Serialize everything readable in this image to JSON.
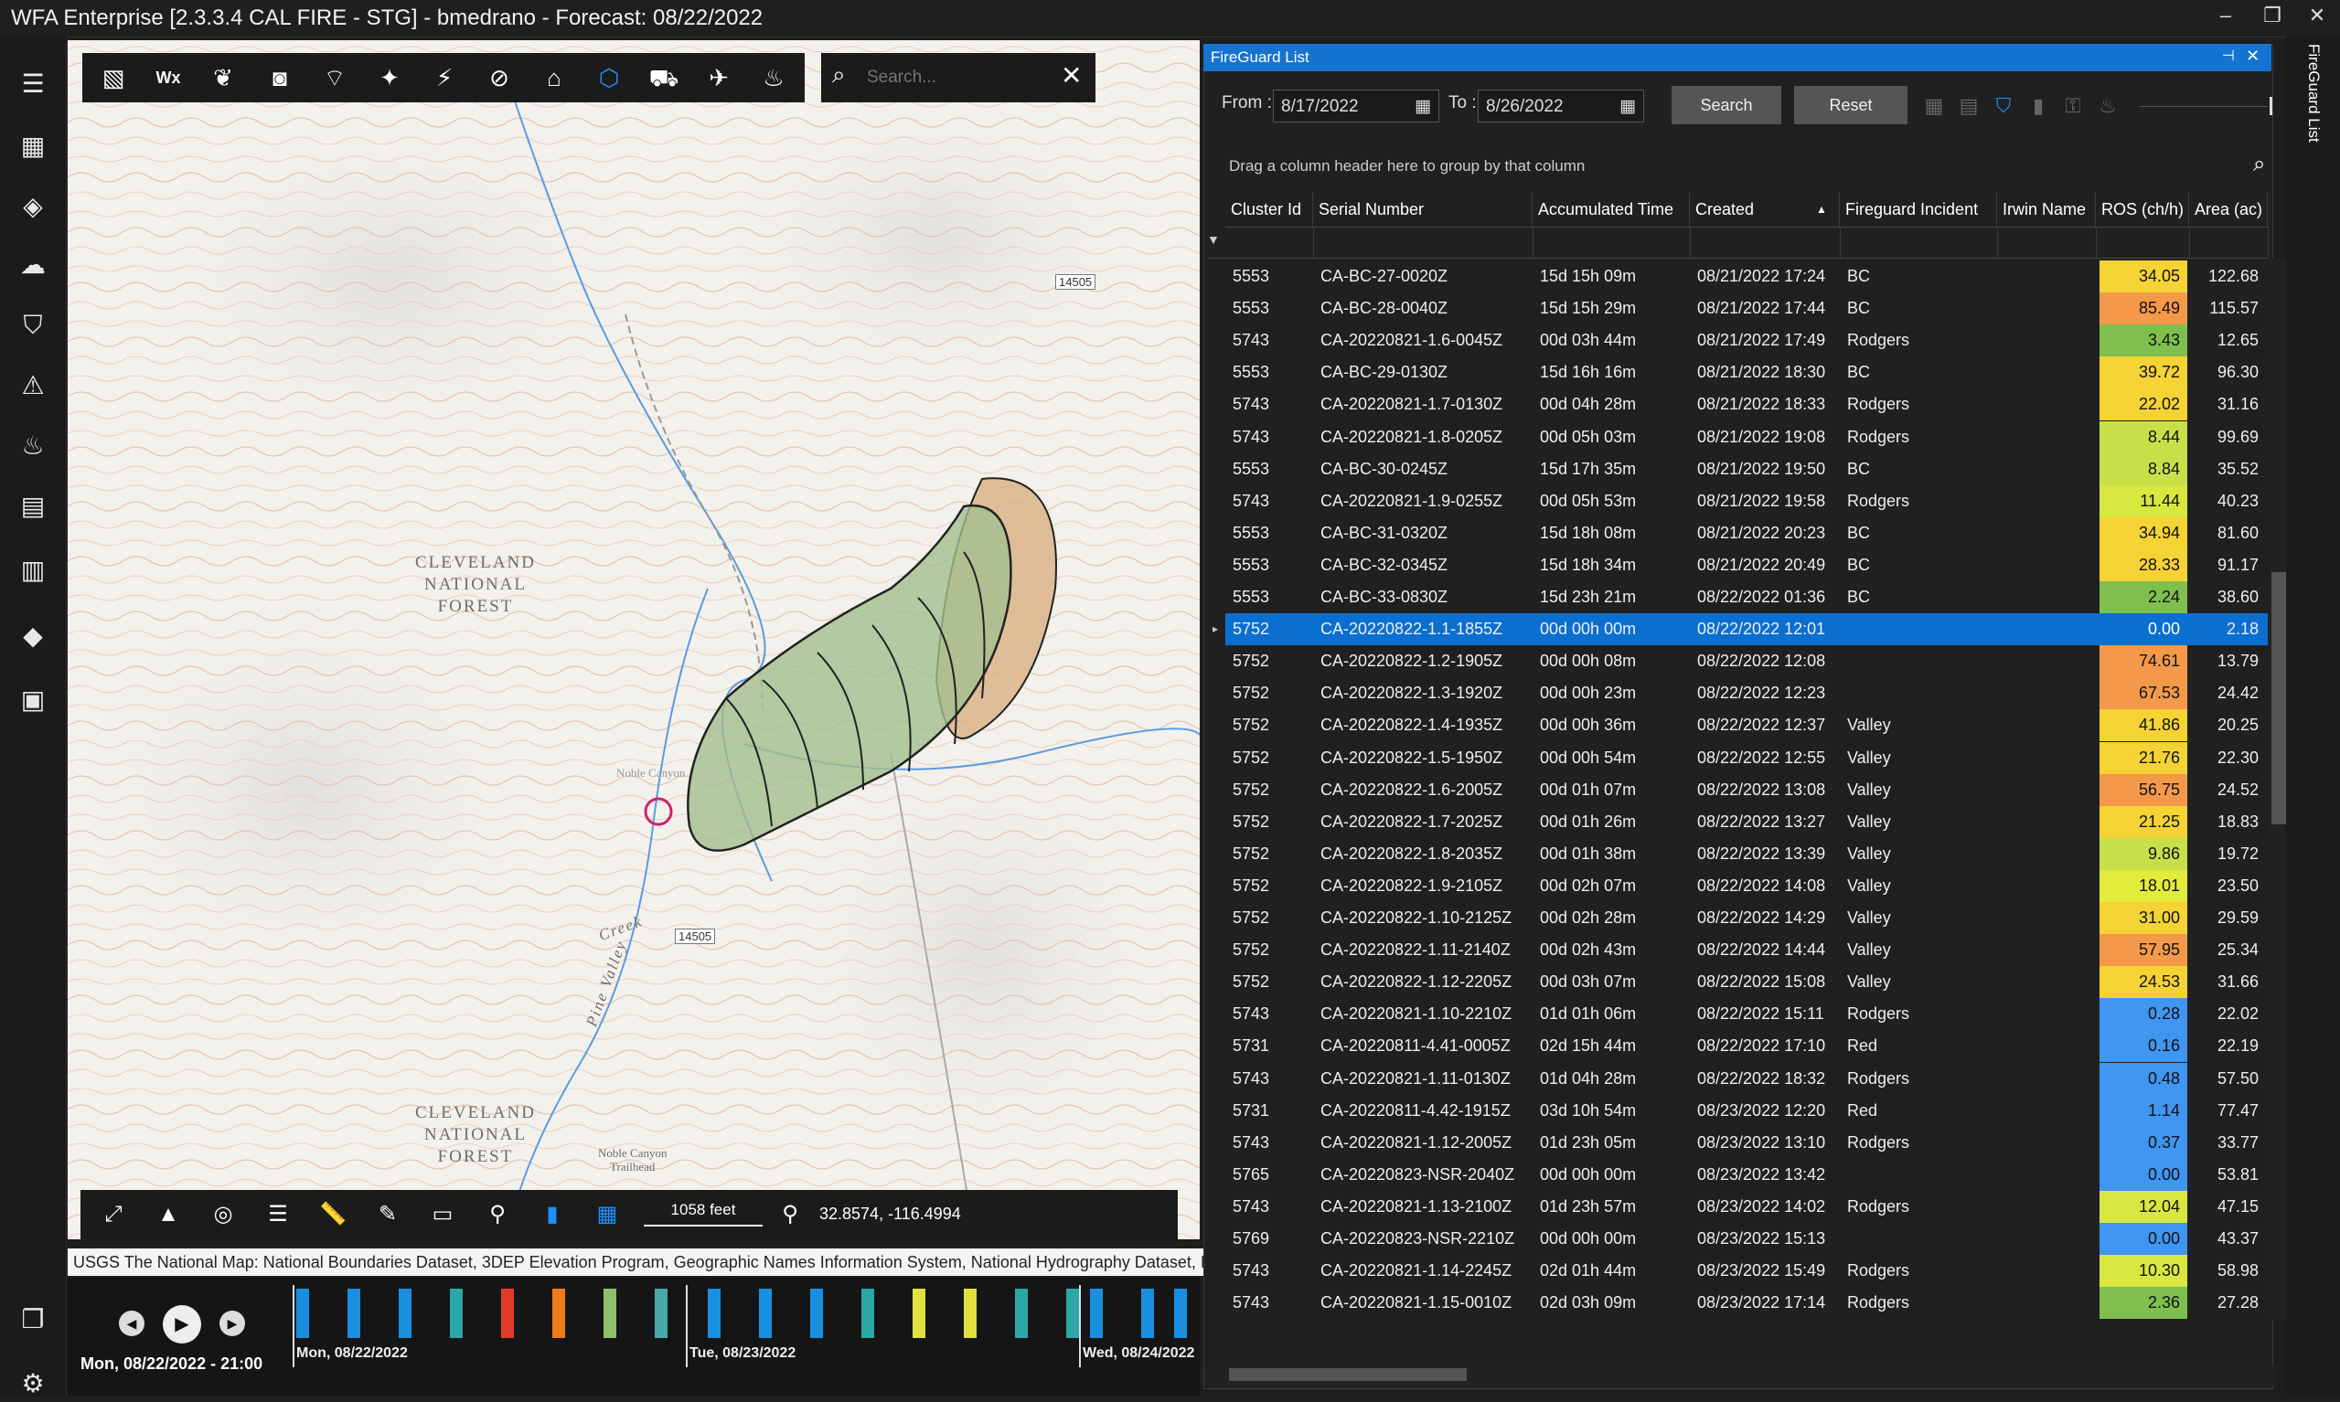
{
  "app": {
    "title": "WFA Enterprise [2.3.3.4 CAL FIRE - STG] - bmedrano - Forecast: 08/22/2022",
    "min": "–",
    "max": "❐",
    "close": "✕"
  },
  "map": {
    "search_placeholder": "Search...",
    "labels": {
      "forest1": "CLEVELAND\nNATIONAL\nFOREST",
      "forest2": "CLEVELAND\nNATIONAL\nFOREST",
      "creek": "Creek",
      "valley": "Pine Valley",
      "trailhead": "Noble Canyon\nTrailhead",
      "canyon": "Noble Canyon"
    },
    "shields": [
      "14505",
      "14505"
    ],
    "scale": "1058 feet",
    "coords": "32.8574, -116.4994",
    "attribution": "USGS The National Map: National Boundaries Dataset, 3DEP Elevation Program, Geographic Names Information System, National Hydrography Dataset, Nat"
  },
  "timeline": {
    "current": "Mon, 08/22/2022 - 21:00",
    "dates": [
      "Mon, 08/22/2022",
      "Tue, 08/23/2022",
      "Wed, 08/24/2022"
    ],
    "bars": [
      "#1a8fe0",
      "#1a8fe0",
      "#1a8fe0",
      "#2aa8a8",
      "#e23b2a",
      "#ee7a1a",
      "#8fbf6a",
      "#4aa8a8",
      "#1a8fe0",
      "#1a8fe0",
      "#1a8fe0",
      "#2aa8a8",
      "#e0e040",
      "#e0e040",
      "#2aa8a8",
      "#2aa8a8",
      "#1a8fe0",
      "#1a8fe0",
      "#1a8fe0"
    ]
  },
  "panel": {
    "title": "FireGuard List",
    "side_tab": "FireGuard List",
    "from_label": "From :",
    "from_value": "8/17/2022",
    "to_label": "To :",
    "to_value": "8/26/2022",
    "search_button": "Search",
    "reset_button": "Reset",
    "group_hint": "Drag a column header here to group by that column",
    "columns": [
      "Cluster Id",
      "Serial Number",
      "Accumulated Time",
      "Created",
      "Fireguard Incident",
      "Irwin Name",
      "ROS (ch/h)",
      "Area (ac)"
    ],
    "rows": [
      {
        "cluster": "5553",
        "serial": "CA-BC-27-0020Z",
        "acc": "15d 15h 09m",
        "created": "08/21/2022 17:24",
        "incident": "BC",
        "irwin": "",
        "ros": "34.05",
        "area": "122.68",
        "color": "#f5d335"
      },
      {
        "cluster": "5553",
        "serial": "CA-BC-28-0040Z",
        "acc": "15d 15h 29m",
        "created": "08/21/2022 17:44",
        "incident": "BC",
        "irwin": "",
        "ros": "85.49",
        "area": "115.57",
        "color": "#f4994a"
      },
      {
        "cluster": "5743",
        "serial": "CA-20220821-1.6-0045Z",
        "acc": "00d 03h 44m",
        "created": "08/21/2022 17:49",
        "incident": "Rodgers",
        "irwin": "",
        "ros": "3.43",
        "area": "12.65",
        "color": "#7fbf4f"
      },
      {
        "cluster": "5553",
        "serial": "CA-BC-29-0130Z",
        "acc": "15d 16h 16m",
        "created": "08/21/2022 18:30",
        "incident": "BC",
        "irwin": "",
        "ros": "39.72",
        "area": "96.30",
        "color": "#f5d335"
      },
      {
        "cluster": "5743",
        "serial": "CA-20220821-1.7-0130Z",
        "acc": "00d 04h 28m",
        "created": "08/21/2022 18:33",
        "incident": "Rodgers",
        "irwin": "",
        "ros": "22.02",
        "area": "31.16",
        "color": "#f5d335"
      },
      {
        "cluster": "5743",
        "serial": "CA-20220821-1.8-0205Z",
        "acc": "00d 05h 03m",
        "created": "08/21/2022 19:08",
        "incident": "Rodgers",
        "irwin": "",
        "ros": "8.44",
        "area": "99.69",
        "color": "#c7e04a"
      },
      {
        "cluster": "5553",
        "serial": "CA-BC-30-0245Z",
        "acc": "15d 17h 35m",
        "created": "08/21/2022 19:50",
        "incident": "BC",
        "irwin": "",
        "ros": "8.84",
        "area": "35.52",
        "color": "#c7e04a"
      },
      {
        "cluster": "5743",
        "serial": "CA-20220821-1.9-0255Z",
        "acc": "00d 05h 53m",
        "created": "08/21/2022 19:58",
        "incident": "Rodgers",
        "irwin": "",
        "ros": "11.44",
        "area": "40.23",
        "color": "#d8e840"
      },
      {
        "cluster": "5553",
        "serial": "CA-BC-31-0320Z",
        "acc": "15d 18h 08m",
        "created": "08/21/2022 20:23",
        "incident": "BC",
        "irwin": "",
        "ros": "34.94",
        "area": "81.60",
        "color": "#f5d335"
      },
      {
        "cluster": "5553",
        "serial": "CA-BC-32-0345Z",
        "acc": "15d 18h 34m",
        "created": "08/21/2022 20:49",
        "incident": "BC",
        "irwin": "",
        "ros": "28.33",
        "area": "91.17",
        "color": "#f5d335"
      },
      {
        "cluster": "5553",
        "serial": "CA-BC-33-0830Z",
        "acc": "15d 23h 21m",
        "created": "08/22/2022 01:36",
        "incident": "BC",
        "irwin": "",
        "ros": "2.24",
        "area": "38.60",
        "color": "#7fbf4f"
      },
      {
        "cluster": "5752",
        "serial": "CA-20220822-1.1-1855Z",
        "acc": "00d 00h 00m",
        "created": "08/22/2022 12:01",
        "incident": "",
        "irwin": "",
        "ros": "0.00",
        "area": "2.18",
        "color": "#0b6fd0",
        "selected": true
      },
      {
        "cluster": "5752",
        "serial": "CA-20220822-1.2-1905Z",
        "acc": "00d 00h 08m",
        "created": "08/22/2022 12:08",
        "incident": "",
        "irwin": "",
        "ros": "74.61",
        "area": "13.79",
        "color": "#f4994a"
      },
      {
        "cluster": "5752",
        "serial": "CA-20220822-1.3-1920Z",
        "acc": "00d 00h 23m",
        "created": "08/22/2022 12:23",
        "incident": "",
        "irwin": "",
        "ros": "67.53",
        "area": "24.42",
        "color": "#f4994a"
      },
      {
        "cluster": "5752",
        "serial": "CA-20220822-1.4-1935Z",
        "acc": "00d 00h 36m",
        "created": "08/22/2022 12:37",
        "incident": "Valley",
        "irwin": "",
        "ros": "41.86",
        "area": "20.25",
        "color": "#f5d335"
      },
      {
        "cluster": "5752",
        "serial": "CA-20220822-1.5-1950Z",
        "acc": "00d 00h 54m",
        "created": "08/22/2022 12:55",
        "incident": "Valley",
        "irwin": "",
        "ros": "21.76",
        "area": "22.30",
        "color": "#f5d335"
      },
      {
        "cluster": "5752",
        "serial": "CA-20220822-1.6-2005Z",
        "acc": "00d 01h 07m",
        "created": "08/22/2022 13:08",
        "incident": "Valley",
        "irwin": "",
        "ros": "56.75",
        "area": "24.52",
        "color": "#f4994a"
      },
      {
        "cluster": "5752",
        "serial": "CA-20220822-1.7-2025Z",
        "acc": "00d 01h 26m",
        "created": "08/22/2022 13:27",
        "incident": "Valley",
        "irwin": "",
        "ros": "21.25",
        "area": "18.83",
        "color": "#f5d335"
      },
      {
        "cluster": "5752",
        "serial": "CA-20220822-1.8-2035Z",
        "acc": "00d 01h 38m",
        "created": "08/22/2022 13:39",
        "incident": "Valley",
        "irwin": "",
        "ros": "9.86",
        "area": "19.72",
        "color": "#c7e04a"
      },
      {
        "cluster": "5752",
        "serial": "CA-20220822-1.9-2105Z",
        "acc": "00d 02h 07m",
        "created": "08/22/2022 14:08",
        "incident": "Valley",
        "irwin": "",
        "ros": "18.01",
        "area": "23.50",
        "color": "#e2ec3a"
      },
      {
        "cluster": "5752",
        "serial": "CA-20220822-1.10-2125Z",
        "acc": "00d 02h 28m",
        "created": "08/22/2022 14:29",
        "incident": "Valley",
        "irwin": "",
        "ros": "31.00",
        "area": "29.59",
        "color": "#f5d335"
      },
      {
        "cluster": "5752",
        "serial": "CA-20220822-1.11-2140Z",
        "acc": "00d 02h 43m",
        "created": "08/22/2022 14:44",
        "incident": "Valley",
        "irwin": "",
        "ros": "57.95",
        "area": "25.34",
        "color": "#f4994a"
      },
      {
        "cluster": "5752",
        "serial": "CA-20220822-1.12-2205Z",
        "acc": "00d 03h 07m",
        "created": "08/22/2022 15:08",
        "incident": "Valley",
        "irwin": "",
        "ros": "24.53",
        "area": "31.66",
        "color": "#f5d335"
      },
      {
        "cluster": "5743",
        "serial": "CA-20220821-1.10-2210Z",
        "acc": "01d 01h 06m",
        "created": "08/22/2022 15:11",
        "incident": "Rodgers",
        "irwin": "",
        "ros": "0.28",
        "area": "22.02",
        "color": "#3f95f0"
      },
      {
        "cluster": "5731",
        "serial": "CA-20220811-4.41-0005Z",
        "acc": "02d 15h 44m",
        "created": "08/22/2022 17:10",
        "incident": "Red",
        "irwin": "",
        "ros": "0.16",
        "area": "22.19",
        "color": "#3f95f0"
      },
      {
        "cluster": "5743",
        "serial": "CA-20220821-1.11-0130Z",
        "acc": "01d 04h 28m",
        "created": "08/22/2022 18:32",
        "incident": "Rodgers",
        "irwin": "",
        "ros": "0.48",
        "area": "57.50",
        "color": "#3f95f0"
      },
      {
        "cluster": "5731",
        "serial": "CA-20220811-4.42-1915Z",
        "acc": "03d 10h 54m",
        "created": "08/23/2022 12:20",
        "incident": "Red",
        "irwin": "",
        "ros": "1.14",
        "area": "77.47",
        "color": "#3f95f0"
      },
      {
        "cluster": "5743",
        "serial": "CA-20220821-1.12-2005Z",
        "acc": "01d 23h 05m",
        "created": "08/23/2022 13:10",
        "incident": "Rodgers",
        "irwin": "",
        "ros": "0.37",
        "area": "33.77",
        "color": "#3f95f0"
      },
      {
        "cluster": "5765",
        "serial": "CA-20220823-NSR-2040Z",
        "acc": "00d 00h 00m",
        "created": "08/23/2022 13:42",
        "incident": "",
        "irwin": "",
        "ros": "0.00",
        "area": "53.81",
        "color": "#3f95f0"
      },
      {
        "cluster": "5743",
        "serial": "CA-20220821-1.13-2100Z",
        "acc": "01d 23h 57m",
        "created": "08/23/2022 14:02",
        "incident": "Rodgers",
        "irwin": "",
        "ros": "12.04",
        "area": "47.15",
        "color": "#d8e840"
      },
      {
        "cluster": "5769",
        "serial": "CA-20220823-NSR-2210Z",
        "acc": "00d 00h 00m",
        "created": "08/23/2022 15:13",
        "incident": "",
        "irwin": "",
        "ros": "0.00",
        "area": "43.37",
        "color": "#3f95f0"
      },
      {
        "cluster": "5743",
        "serial": "CA-20220821-1.14-2245Z",
        "acc": "02d 01h 44m",
        "created": "08/23/2022 15:49",
        "incident": "Rodgers",
        "irwin": "",
        "ros": "10.30",
        "area": "58.98",
        "color": "#d8e840"
      },
      {
        "cluster": "5743",
        "serial": "CA-20220821-1.15-0010Z",
        "acc": "02d 03h 09m",
        "created": "08/23/2022 17:14",
        "incident": "Rodgers",
        "irwin": "",
        "ros": "2.36",
        "area": "27.28",
        "color": "#7fbf4f"
      }
    ]
  }
}
